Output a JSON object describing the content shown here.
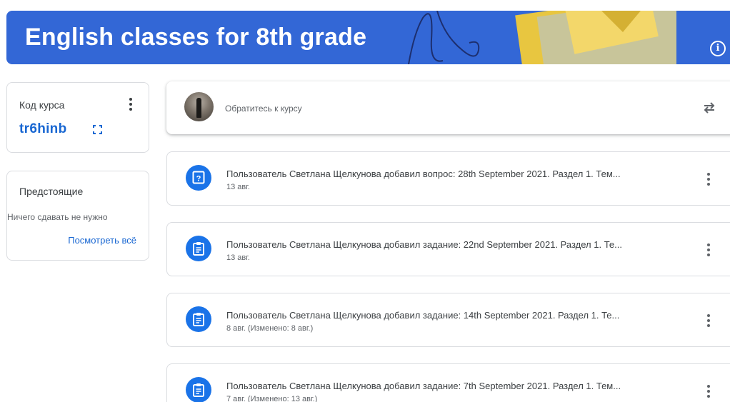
{
  "banner": {
    "title": "English classes for 8th grade"
  },
  "course_code": {
    "label": "Код курса",
    "value": "tr6hinb"
  },
  "upcoming": {
    "title": "Предстоящие",
    "empty_text": "Ничего сдавать не нужно",
    "view_all": "Посмотреть всё"
  },
  "announce": {
    "placeholder": "Обратитесь к курсу"
  },
  "stream": [
    {
      "type": "question",
      "title": "Пользователь Светлана Щелкунова добавил вопрос: 28th September 2021. Раздел 1. Тем...",
      "date": "13 авг."
    },
    {
      "type": "assignment",
      "title": "Пользователь Светлана Щелкунова добавил задание: 22nd September 2021. Раздел 1. Те...",
      "date": "13 авг."
    },
    {
      "type": "assignment",
      "title": "Пользователь Светлана Щелкунова добавил задание: 14th September 2021. Раздел 1. Те...",
      "date": "8 авг. (Изменено: 8 авг.)"
    },
    {
      "type": "assignment",
      "title": "Пользователь Светлана Щелкунова добавил задание: 7th September 2021. Раздел 1. Тем...",
      "date": "7 авг. (Изменено: 13 авг.)"
    }
  ],
  "icons": {
    "info": "info-icon",
    "more": "more-vert-icon",
    "fullscreen": "fullscreen-icon",
    "repost": "repost-icon",
    "question": "question-icon",
    "assignment": "assignment-icon"
  },
  "colors": {
    "banner": "#3367d6",
    "accent": "#1967d2",
    "icon_bg": "#1a73e8"
  }
}
